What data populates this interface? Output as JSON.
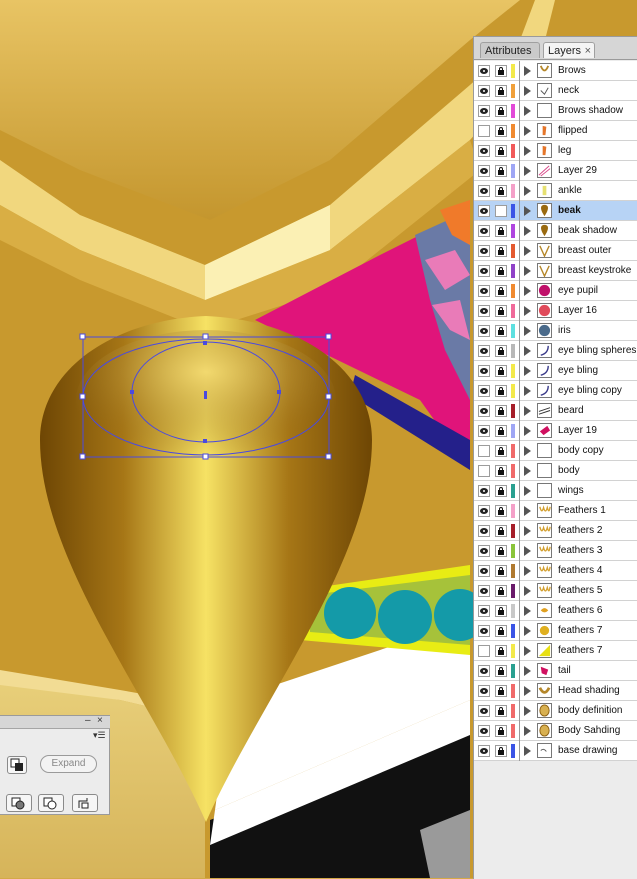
{
  "layers_panel": {
    "tabs": [
      {
        "label": "Attributes"
      },
      {
        "label": "Layers"
      }
    ],
    "close_glyph": "×",
    "layers": [
      {
        "name": "Brows",
        "color": "#f3e94a",
        "visible": true,
        "thumb": "brows"
      },
      {
        "name": "neck",
        "color": "#f0a03a",
        "visible": true,
        "thumb": "neck"
      },
      {
        "name": "Brows shadow",
        "color": "#e24ad8",
        "visible": true,
        "thumb": "blank"
      },
      {
        "name": "flipped",
        "color": "#f08a30",
        "visible": false,
        "thumb": "leg"
      },
      {
        "name": "leg",
        "color": "#f15a5a",
        "visible": true,
        "thumb": "leg"
      },
      {
        "name": "Layer 29",
        "color": "#9fa6f5",
        "visible": true,
        "thumb": "line"
      },
      {
        "name": "ankle",
        "color": "#f4a0c8",
        "visible": true,
        "thumb": "ankle"
      },
      {
        "name": "beak",
        "color": "#3b54e6",
        "visible": true,
        "thumb": "beak",
        "selected": true
      },
      {
        "name": "beak shadow",
        "color": "#b046e0",
        "visible": true,
        "thumb": "beak"
      },
      {
        "name": "breast outer",
        "color": "#e45a30",
        "visible": true,
        "thumb": "breast"
      },
      {
        "name": "breast keystroke",
        "color": "#9042c8",
        "visible": true,
        "thumb": "breast"
      },
      {
        "name": "eye pupil",
        "color": "#f08a30",
        "visible": true,
        "thumb": "pupil"
      },
      {
        "name": "Layer 16",
        "color": "#f06a9a",
        "visible": true,
        "thumb": "red"
      },
      {
        "name": "iris",
        "color": "#5ee0e0",
        "visible": true,
        "thumb": "iris"
      },
      {
        "name": "eye bling spheres",
        "color": "#b8b8b8",
        "visible": true,
        "thumb": "bling"
      },
      {
        "name": "eye bling",
        "color": "#f3e94a",
        "visible": true,
        "thumb": "bling"
      },
      {
        "name": "eye bling copy",
        "color": "#f3e94a",
        "visible": true,
        "thumb": "bling"
      },
      {
        "name": "beard",
        "color": "#a61e2a",
        "visible": true,
        "thumb": "beard"
      },
      {
        "name": "Layer 19",
        "color": "#9fa6f5",
        "visible": true,
        "thumb": "layer19"
      },
      {
        "name": "body copy",
        "color": "#f06a6a",
        "visible": false,
        "thumb": "blank"
      },
      {
        "name": "body",
        "color": "#f06a6a",
        "visible": false,
        "thumb": "blank"
      },
      {
        "name": "wings",
        "color": "#2aa090",
        "visible": true,
        "thumb": "blank"
      },
      {
        "name": "Feathers 1",
        "color": "#f4a0c8",
        "visible": true,
        "thumb": "feathers"
      },
      {
        "name": "feathers 2",
        "color": "#a61e2a",
        "visible": true,
        "thumb": "feathers"
      },
      {
        "name": "feathers 3",
        "color": "#8ac43a",
        "visible": true,
        "thumb": "feathers"
      },
      {
        "name": "feathers 4",
        "color": "#b07a30",
        "visible": true,
        "thumb": "feathers"
      },
      {
        "name": "feathers 5",
        "color": "#6a1a6a",
        "visible": true,
        "thumb": "feathers"
      },
      {
        "name": "feathers 6",
        "color": "#c8c8c8",
        "visible": true,
        "thumb": "feathers6"
      },
      {
        "name": "feathers 7",
        "color": "#3b54e6",
        "visible": true,
        "thumb": "feathers7"
      },
      {
        "name": "feathers 7",
        "color": "#f3e94a",
        "visible": false,
        "thumb": "yellowtri"
      },
      {
        "name": "tail",
        "color": "#2aa090",
        "visible": true,
        "thumb": "tail"
      },
      {
        "name": "Head shading",
        "color": "#f06a6a",
        "visible": true,
        "thumb": "head"
      },
      {
        "name": "body definition",
        "color": "#f06a6a",
        "visible": true,
        "thumb": "bodydef"
      },
      {
        "name": "Body Sahding",
        "color": "#f06a6a",
        "visible": true,
        "thumb": "bodydef"
      },
      {
        "name": "base drawing",
        "color": "#3b54e6",
        "visible": true,
        "thumb": "base"
      }
    ]
  },
  "pathfinder_panel": {
    "minimize_glyph": "–",
    "close_glyph": "×",
    "menu_glyph": "▾☰",
    "expand_label": "Expand"
  },
  "artwork_colors": {
    "background_gold": "#d4a948",
    "beak_dark": "#7a5206",
    "beak_light": "#f6e264",
    "magenta": "#e0147a",
    "navy": "#24208a",
    "teal": "#149aa8",
    "yellow_band": "#e8ec14",
    "selection_blue": "#4a4ae0"
  }
}
